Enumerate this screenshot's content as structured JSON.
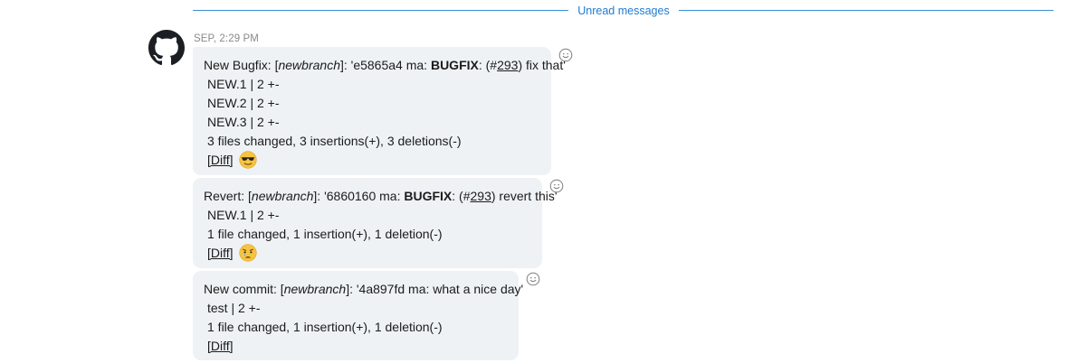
{
  "divider": {
    "label": "Unread messages",
    "color": "#3a8fd6"
  },
  "sender": {
    "avatar_icon": "github-octocat-icon",
    "timestamp": "SEP, 2:29 PM"
  },
  "messages": [
    {
      "lines": [
        {
          "prefix": "New Bugfix: [",
          "branch": "newbranch",
          "mid": "]: 'e5865a4 ma: ",
          "tag": "BUGFIX",
          "pre_issue": ": (#",
          "issue": "293",
          "suffix": ") fix that'"
        },
        {
          "text": "NEW.1 | 2 +-"
        },
        {
          "text": "NEW.2 | 2 +-"
        },
        {
          "text": "NEW.3 | 2 +-"
        },
        {
          "text": "3 files changed, 3 insertions(+), 3 deletions(-)"
        },
        {
          "text": "[Diff]",
          "emoji": "sunglasses-emoji"
        }
      ]
    },
    {
      "lines": [
        {
          "prefix": "Revert: [",
          "branch": "newbranch",
          "mid": "]: '6860160 ma: ",
          "tag": "BUGFIX",
          "pre_issue": ": (#",
          "issue": "293",
          "suffix": ") revert this'"
        },
        {
          "text": "NEW.1 | 2 +-"
        },
        {
          "text": "1 file changed, 1 insertion(+), 1 deletion(-)"
        },
        {
          "text": "[Diff]",
          "emoji": "sad-tear-emoji"
        }
      ]
    },
    {
      "lines": [
        {
          "prefix": "New commit: [",
          "branch": "newbranch",
          "mid": "]: '4a897fd ma: what a nice day'"
        },
        {
          "text": "test | 2 +-"
        },
        {
          "text": "1 file changed, 1 insertion(+), 1 deletion(-)"
        },
        {
          "text": "[Diff]"
        }
      ]
    }
  ],
  "reaction_icon": "smiley-reaction-icon",
  "colors": {
    "bubble": "#eef2f5",
    "accent": "#1f7bd2",
    "timestamp": "#8a8a8a"
  }
}
